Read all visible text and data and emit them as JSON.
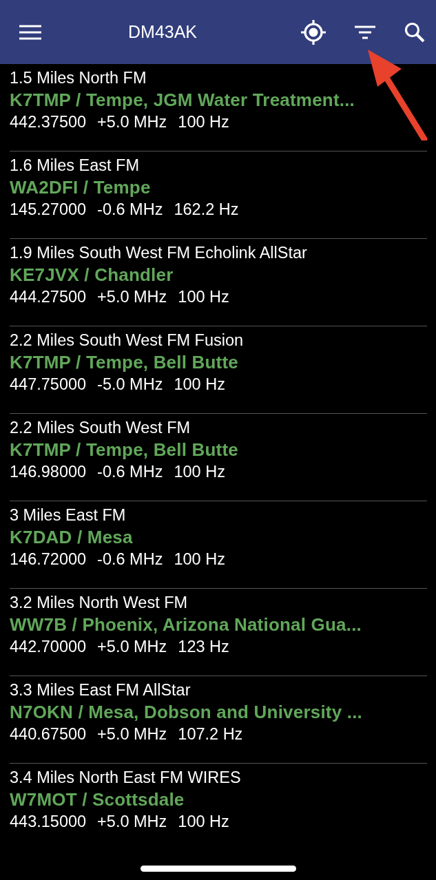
{
  "app_bar": {
    "title": "DM43AK"
  },
  "repeaters": [
    {
      "distance": "1.5 Miles North FM",
      "name": "K7TMP / Tempe, JGM Water Treatment...",
      "frequency": "442.37500",
      "offset": "+5.0 MHz",
      "tone": "100 Hz"
    },
    {
      "distance": "1.6 Miles East FM",
      "name": "WA2DFI / Tempe",
      "frequency": "145.27000",
      "offset": "-0.6 MHz",
      "tone": "162.2 Hz"
    },
    {
      "distance": "1.9 Miles South West FM Echolink AllStar",
      "name": "KE7JVX / Chandler",
      "frequency": "444.27500",
      "offset": "+5.0 MHz",
      "tone": "100 Hz"
    },
    {
      "distance": "2.2 Miles South West FM Fusion",
      "name": "K7TMP / Tempe, Bell Butte",
      "frequency": "447.75000",
      "offset": "-5.0 MHz",
      "tone": "100 Hz"
    },
    {
      "distance": "2.2 Miles South West FM",
      "name": "K7TMP / Tempe, Bell Butte",
      "frequency": "146.98000",
      "offset": "-0.6 MHz",
      "tone": "100 Hz"
    },
    {
      "distance": "3 Miles East FM",
      "name": "K7DAD / Mesa",
      "frequency": "146.72000",
      "offset": "-0.6 MHz",
      "tone": "100 Hz"
    },
    {
      "distance": "3.2 Miles North West FM",
      "name": "WW7B / Phoenix, Arizona National Gua...",
      "frequency": "442.70000",
      "offset": "+5.0 MHz",
      "tone": "123 Hz"
    },
    {
      "distance": "3.3 Miles East FM AllStar",
      "name": "N7OKN / Mesa, Dobson and University ...",
      "frequency": "440.67500",
      "offset": "+5.0 MHz",
      "tone": "107.2 Hz"
    },
    {
      "distance": "3.4 Miles North East FM WIRES",
      "name": "W7MOT / Scottsdale",
      "frequency": "443.15000",
      "offset": "+5.0 MHz",
      "tone": "100 Hz"
    }
  ]
}
